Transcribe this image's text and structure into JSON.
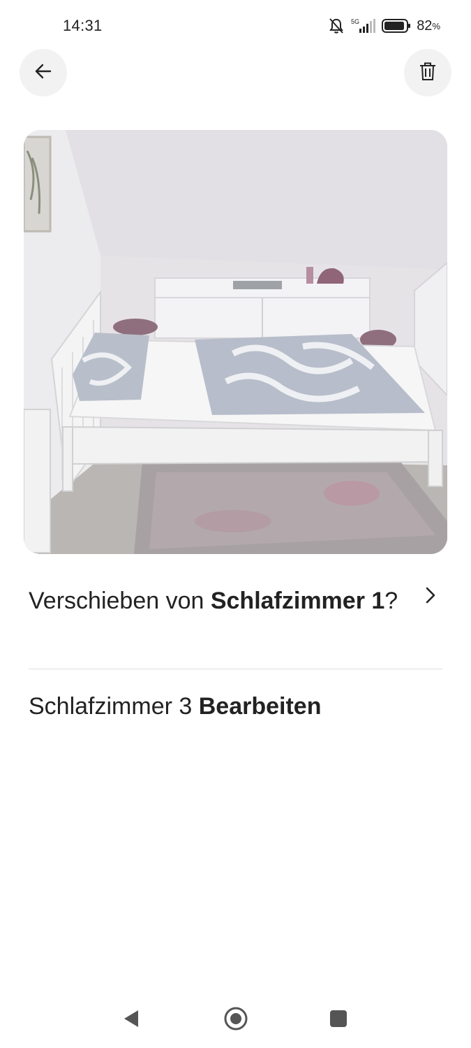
{
  "status_bar": {
    "time": "14:31",
    "network": "5G",
    "battery_percent": "82",
    "battery_unit": "%",
    "icons": [
      "bell-muted-icon",
      "signal-icon",
      "battery-icon"
    ]
  },
  "header": {
    "back_icon": "arrow-left-icon",
    "delete_icon": "trash-icon"
  },
  "photo": {
    "subject": "bedroom"
  },
  "move_row": {
    "prefix": "Verschieben von ",
    "room": "Schlafzimmer 1",
    "suffix": "?",
    "chevron_icon": "chevron-right-icon"
  },
  "edit_row": {
    "room": "Schlafzimmer 3 ",
    "action": "Bearbeiten"
  },
  "nav_bar": {
    "icons": [
      "nav-back-icon",
      "nav-home-icon",
      "nav-recents-icon"
    ]
  },
  "colors": {
    "text": "#222222",
    "button_bg": "#f2f2f2",
    "divider": "#dddddd"
  }
}
